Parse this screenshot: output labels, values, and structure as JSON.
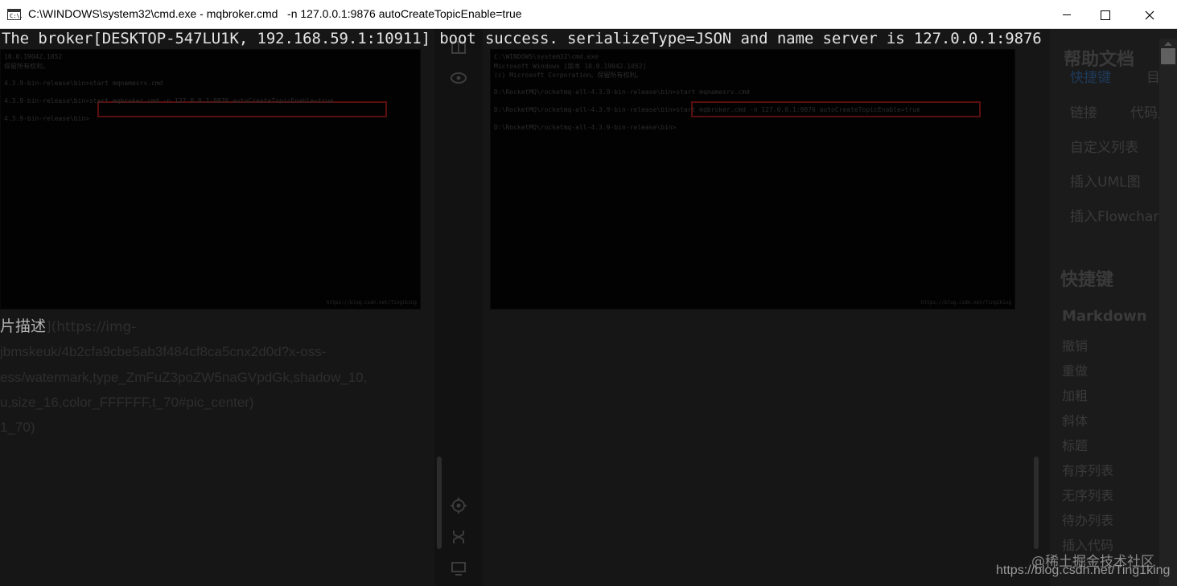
{
  "window": {
    "title": "C:\\WINDOWS\\system32\\cmd.exe - mqbroker.cmd   -n 127.0.0.1:9876 autoCreateTopicEnable=true",
    "icon": "cmd-icon",
    "icon_text": "C:\\."
  },
  "console": {
    "line": "The broker[DESKTOP-547LU1K, 192.168.59.1:10911] boot success. serializeType=JSON and name server is 127.0.0.1:9876"
  },
  "background": {
    "left_shot_lines": [
      "10.0.19042.1052",
      "保留所有权利。",
      "",
      "4.3.9-bin-release\\bin>start mqnamesrv.cmd",
      "",
      "4.3.9-bin-release\\bin>start mqbroker.cmd -n 127.0.0.1:9876 autoCreateTopicEnable=true",
      "",
      "4.3.9-bin-release\\bin>"
    ],
    "right_shot_lines": [
      "C:\\WINDOWS\\system32\\cmd.exe",
      "Microsoft Windows [版本 10.0.19042.1052]",
      "(c) Microsoft Corporation。保留所有权利。",
      "",
      "D:\\RocketMQ\\rocketmq-all-4.3.9-bin-release\\bin>start mqnamesrv.cmd",
      "",
      "D:\\RocketMQ\\rocketmq-all-4.3.9-bin-release\\bin>start mqbroker.cmd -n 127.0.0.1:9876 autoCreateTopicEnable=true",
      "",
      "D:\\RocketMQ\\rocketmq-all-4.3.9-bin-release\\bin>"
    ],
    "shot_watermark": "https://blog.csdn.net/Ting1king",
    "pic_desc_label": "片描述",
    "pic_desc_rest": "](https://img-",
    "url_lines": [
      "jbmskeuk/4b2cfa9cbe5ab3f484cf8ca5cnx2d0d?x-oss-",
      "ess/watermark,type_ZmFuZ3poZW5naGVpdGk,shadow_10,",
      "u,size_16,color_FFFFFF,t_70#pic_center)",
      "1_70)"
    ],
    "help": {
      "title": "帮助文档",
      "tags": [
        "快捷键",
        "目录",
        "链接",
        "代码片",
        "自定义列表",
        "插入UML图",
        "插入Flowchart流"
      ],
      "section": "快捷键",
      "subsection": "Markdown",
      "items": [
        "撤销",
        "重做",
        "加粗",
        "斜体",
        "标题",
        "有序列表",
        "无序列表",
        "待办列表",
        "插入代码"
      ]
    }
  },
  "watermarks": {
    "line1": "@稀土掘金技术社区",
    "line2": "https://blog.csdn.net/Ting1king"
  }
}
